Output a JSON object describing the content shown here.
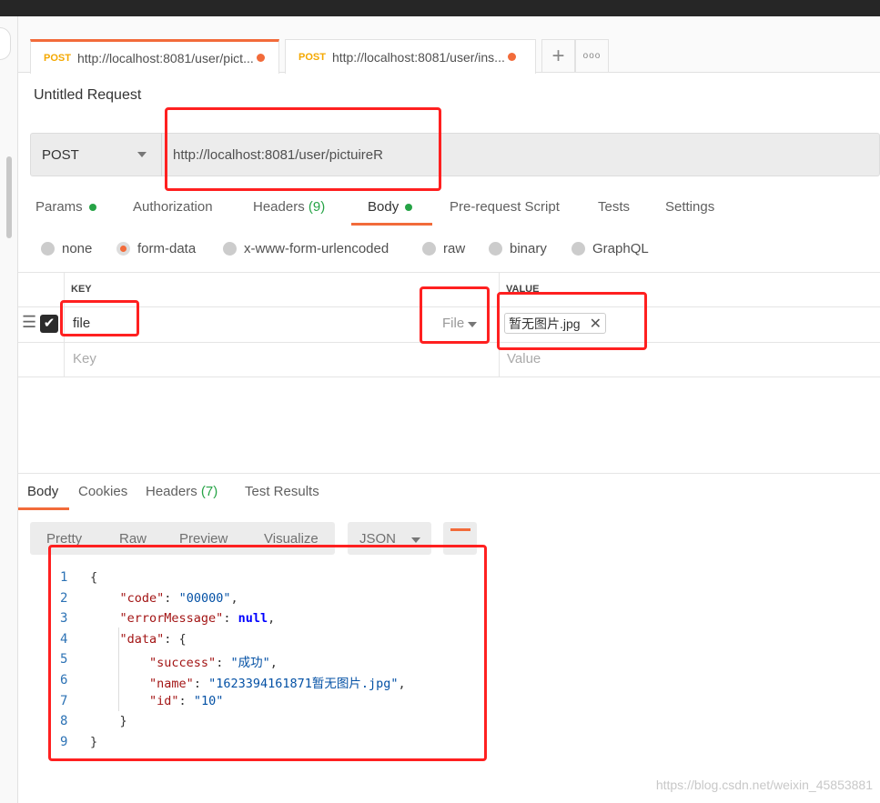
{
  "tabs": [
    {
      "method": "POST",
      "url": "http://localhost:8081/user/pict..."
    },
    {
      "method": "POST",
      "url": "http://localhost:8081/user/ins..."
    }
  ],
  "tab_icons": {
    "add": "plus-icon",
    "more": "ellipsis-icon"
  },
  "request": {
    "title": "Untitled Request",
    "method": "POST",
    "url": "http://localhost:8081/user/pictuireR"
  },
  "subtabs": {
    "params": "Params",
    "authorization": "Authorization",
    "headers": "Headers",
    "headers_count": "(9)",
    "body": "Body",
    "prerequest": "Pre-request Script",
    "tests": "Tests",
    "settings": "Settings"
  },
  "body_modes": [
    "none",
    "form-data",
    "x-www-form-urlencoded",
    "raw",
    "binary",
    "GraphQL"
  ],
  "selected_body_mode": "form-data",
  "form_table": {
    "key_header": "KEY",
    "value_header": "VALUE",
    "row": {
      "key": "file",
      "type": "File",
      "value": "暂无图片.jpg",
      "checked": true
    },
    "placeholder_key": "Key",
    "placeholder_value": "Value"
  },
  "response_tabs": {
    "body": "Body",
    "cookies": "Cookies",
    "headers": "Headers",
    "headers_count": "(7)",
    "tests": "Test Results"
  },
  "view_modes": [
    "Pretty",
    "Raw",
    "Preview",
    "Visualize"
  ],
  "format": "JSON",
  "code_lines": [
    [
      [
        "p",
        "{"
      ]
    ],
    [
      [
        "p",
        "    "
      ],
      [
        "k",
        "\"code\""
      ],
      [
        "p",
        ": "
      ],
      [
        "s",
        "\"00000\""
      ],
      [
        "p",
        ","
      ]
    ],
    [
      [
        "p",
        "    "
      ],
      [
        "k",
        "\"errorMessage\""
      ],
      [
        "p",
        ": "
      ],
      [
        "n",
        "null"
      ],
      [
        "p",
        ","
      ]
    ],
    [
      [
        "p",
        "    "
      ],
      [
        "k",
        "\"data\""
      ],
      [
        "p",
        ": {"
      ]
    ],
    [
      [
        "p",
        "        "
      ],
      [
        "k",
        "\"success\""
      ],
      [
        "p",
        ": "
      ],
      [
        "s",
        "\"成功\""
      ],
      [
        "p",
        ","
      ]
    ],
    [
      [
        "p",
        "        "
      ],
      [
        "k",
        "\"name\""
      ],
      [
        "p",
        ": "
      ],
      [
        "s",
        "\"1623394161871暂无图片.jpg\""
      ],
      [
        "p",
        ","
      ]
    ],
    [
      [
        "p",
        "        "
      ],
      [
        "k",
        "\"id\""
      ],
      [
        "p",
        ": "
      ],
      [
        "s",
        "\"10\""
      ]
    ],
    [
      [
        "p",
        "    }"
      ]
    ],
    [
      [
        "p",
        "}"
      ]
    ]
  ],
  "watermark": "https://blog.csdn.net/weixin_45853881",
  "colors": {
    "accent": "#f26b3a",
    "method": "#f4a800",
    "green": "#26a346",
    "annotation": "#ff2020"
  }
}
